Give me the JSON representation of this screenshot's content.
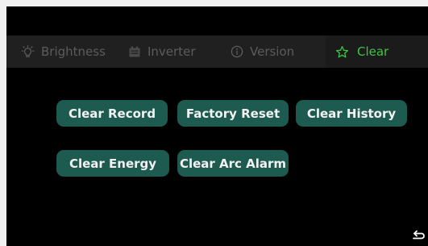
{
  "tabs": [
    {
      "label": "Brightness",
      "icon": "brightness-icon"
    },
    {
      "label": "Inverter",
      "icon": "inverter-icon"
    },
    {
      "label": "Version",
      "icon": "info-icon"
    },
    {
      "label": "Clear",
      "icon": "star-icon",
      "active": true
    }
  ],
  "buttons": {
    "clear_record": "Clear Record",
    "factory_reset": "Factory Reset",
    "clear_history": "Clear History",
    "clear_energy": "Clear Energy",
    "clear_arc_alarm": "Clear Arc Alarm"
  },
  "colors": {
    "background": "#000000",
    "tab_bar": "#202020",
    "tab_text_inactive": "#5c5c5c",
    "tab_text_active": "#3ec641",
    "button": "#1d5a4f",
    "button_text": "#f2f2f2"
  },
  "back_icon": "back-arrow-icon"
}
